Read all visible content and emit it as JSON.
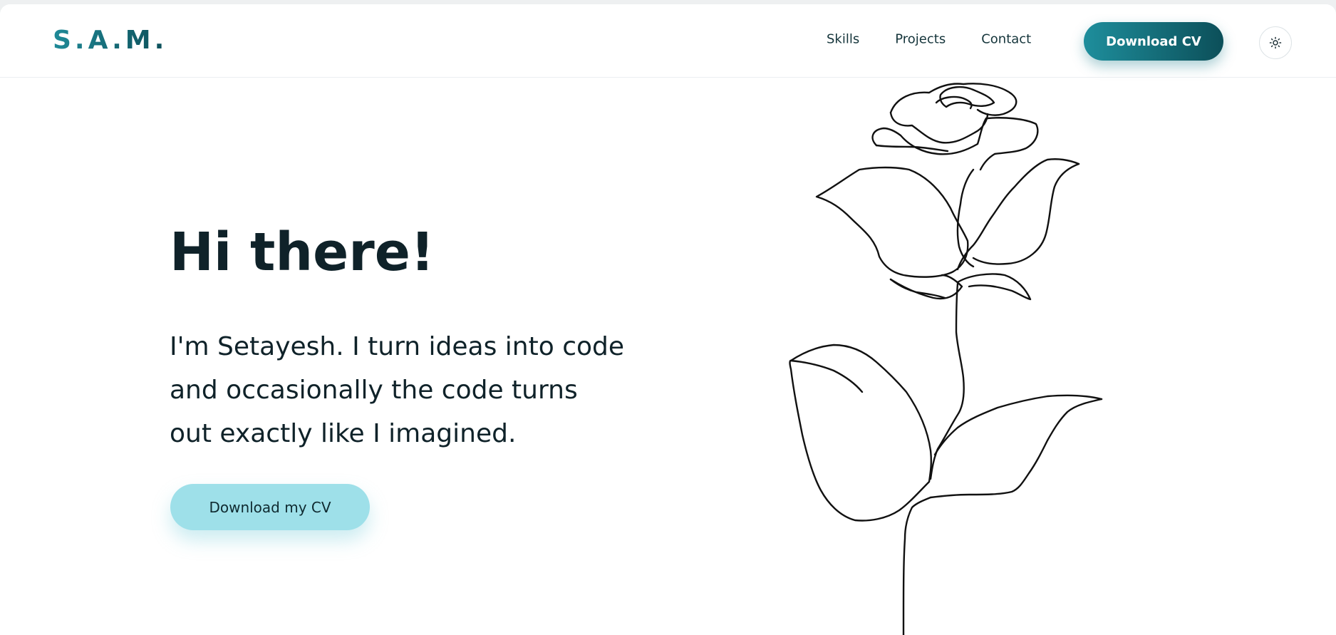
{
  "brand": {
    "logo": "S.A.M.",
    "gradient_start": "#1f8a98",
    "gradient_end": "#0d4f59"
  },
  "nav": {
    "links": [
      "Skills",
      "Projects",
      "Contact"
    ],
    "cv_button": "Download CV",
    "theme_toggle_icon": "sun-icon"
  },
  "hero": {
    "title": "Hi there!",
    "text": "I'm Setayesh. I turn ideas into code and occasionally the code turns out exactly like I imagined.",
    "button": "Download my CV",
    "button_color": "#9ee0e9",
    "illustration_icon": "rose-line-art-icon"
  }
}
